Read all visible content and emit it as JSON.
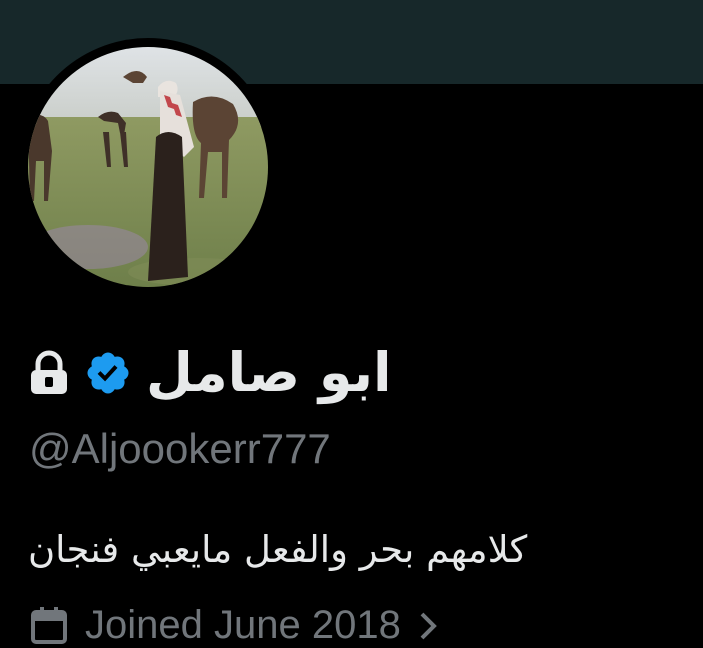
{
  "profile": {
    "display_name": "ابو صامل",
    "handle": "@Aljoookerr777",
    "bio": "كلامهم بحر والفعل مايعبي فنجان",
    "joined": "Joined June 2018",
    "verified": true,
    "protected": true
  },
  "icons": {
    "lock": "lock-icon",
    "verified": "verified-badge-icon",
    "calendar": "calendar-icon",
    "chevron": "chevron-right-icon"
  },
  "colors": {
    "background": "#000000",
    "banner": "#17282a",
    "primary_text": "#e7e9ea",
    "secondary_text": "#71767b",
    "verified_blue": "#1d9bf0"
  }
}
